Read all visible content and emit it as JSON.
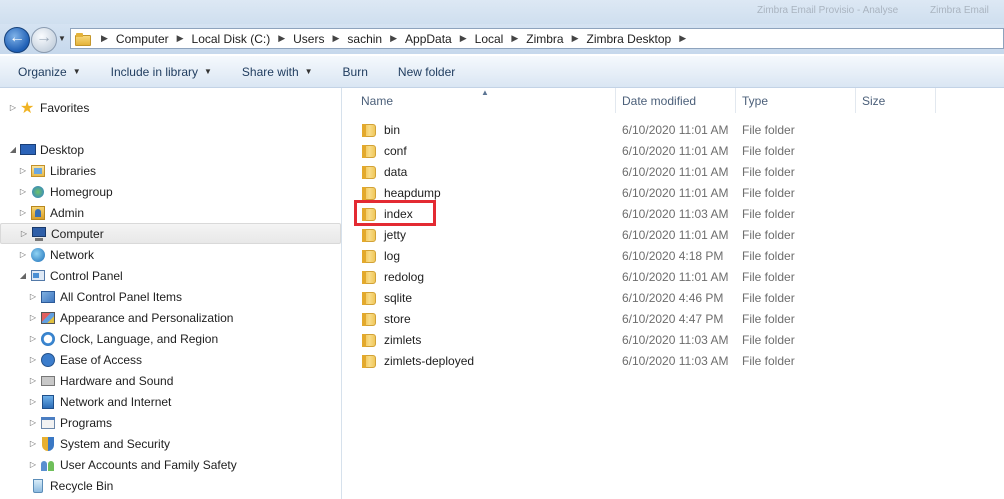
{
  "window": {
    "ghost_text_1": "Zimbra Email Provisio - Analyse",
    "ghost_text_2": "Zimbra Email"
  },
  "address": {
    "crumbs": [
      "Computer",
      "Local Disk (C:)",
      "Users",
      "sachin",
      "AppData",
      "Local",
      "Zimbra",
      "Zimbra Desktop"
    ]
  },
  "toolbar": {
    "organize": "Organize",
    "include_in_library": "Include in library",
    "share_with": "Share with",
    "burn": "Burn",
    "new_folder": "New folder"
  },
  "nav": {
    "favorites": "Favorites",
    "desktop": "Desktop",
    "libraries": "Libraries",
    "homegroup": "Homegroup",
    "admin": "Admin",
    "computer": "Computer",
    "network": "Network",
    "control_panel": "Control Panel",
    "control_items": [
      "All Control Panel Items",
      "Appearance and Personalization",
      "Clock, Language, and Region",
      "Ease of Access",
      "Hardware and Sound",
      "Network and Internet",
      "Programs",
      "System and Security",
      "User Accounts and Family Safety"
    ],
    "recycle_bin": "Recycle Bin"
  },
  "columns": {
    "name": "Name",
    "date_modified": "Date modified",
    "type": "Type",
    "size": "Size"
  },
  "files": [
    {
      "name": "bin",
      "date": "6/10/2020 11:01 AM",
      "type": "File folder"
    },
    {
      "name": "conf",
      "date": "6/10/2020 11:01 AM",
      "type": "File folder"
    },
    {
      "name": "data",
      "date": "6/10/2020 11:01 AM",
      "type": "File folder"
    },
    {
      "name": "heapdump",
      "date": "6/10/2020 11:01 AM",
      "type": "File folder"
    },
    {
      "name": "index",
      "date": "6/10/2020 11:03 AM",
      "type": "File folder"
    },
    {
      "name": "jetty",
      "date": "6/10/2020 11:01 AM",
      "type": "File folder"
    },
    {
      "name": "log",
      "date": "6/10/2020 4:18 PM",
      "type": "File folder"
    },
    {
      "name": "redolog",
      "date": "6/10/2020 11:01 AM",
      "type": "File folder"
    },
    {
      "name": "sqlite",
      "date": "6/10/2020 4:46 PM",
      "type": "File folder"
    },
    {
      "name": "store",
      "date": "6/10/2020 4:47 PM",
      "type": "File folder"
    },
    {
      "name": "zimlets",
      "date": "6/10/2020 11:03 AM",
      "type": "File folder"
    },
    {
      "name": "zimlets-deployed",
      "date": "6/10/2020 11:03 AM",
      "type": "File folder"
    }
  ],
  "colors": {
    "highlight": "#e32a32",
    "toolbar_text": "#1e3b5e",
    "header_text": "#4c607a"
  }
}
